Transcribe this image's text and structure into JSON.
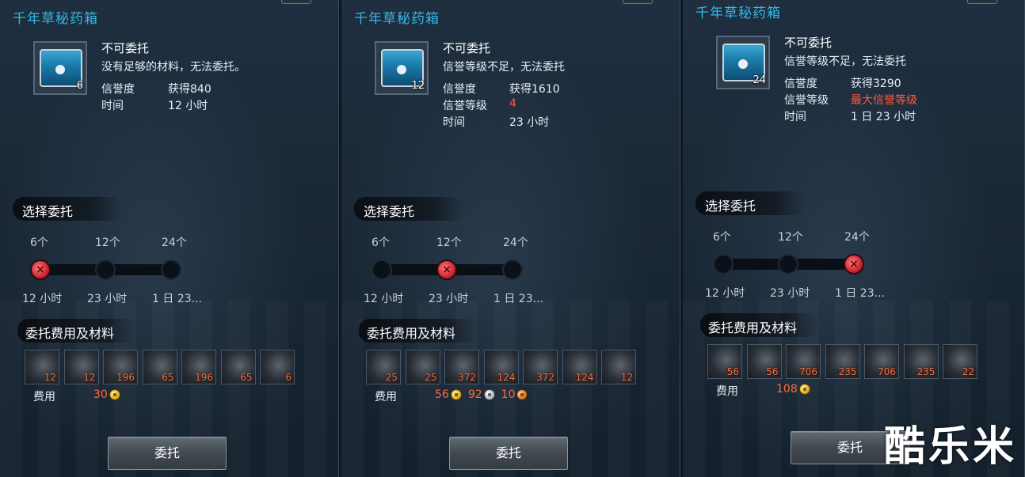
{
  "panels": [
    {
      "title": "千年草秘药箱",
      "item_qty": "6",
      "status": "不可委托",
      "reason": "没有足够的材料，无法委托。",
      "info": [
        {
          "label": "信誉度",
          "value": "获得840",
          "highlight": false
        },
        {
          "label": "时间",
          "value": "12 小时",
          "highlight": false
        }
      ],
      "section_choose": "选择委托",
      "options": [
        "6个",
        "12个",
        "24个"
      ],
      "durations": [
        "12 小时",
        "23 小时",
        "1 日 23..."
      ],
      "selected_option_index": 0,
      "section_cost": "委托费用及材料",
      "materials": [
        "12",
        "12",
        "196",
        "65",
        "196",
        "65",
        "6"
      ],
      "fee_label": "费用",
      "fees": [
        {
          "amount": "30",
          "coin": "gold"
        }
      ],
      "button": "委托"
    },
    {
      "title": "千年草秘药箱",
      "item_qty": "12",
      "status": "不可委托",
      "reason": "信誉等级不足，无法委托",
      "info": [
        {
          "label": "信誉度",
          "value": "获得1610",
          "highlight": false
        },
        {
          "label": "信誉等级",
          "value": "4",
          "highlight": true
        },
        {
          "label": "时间",
          "value": "23 小时",
          "highlight": false
        }
      ],
      "section_choose": "选择委托",
      "options": [
        "6个",
        "12个",
        "24个"
      ],
      "durations": [
        "12 小时",
        "23 小时",
        "1 日 23..."
      ],
      "selected_option_index": 1,
      "section_cost": "委托费用及材料",
      "materials": [
        "25",
        "25",
        "372",
        "124",
        "372",
        "124",
        "12"
      ],
      "fee_label": "费用",
      "fees": [
        {
          "amount": "56",
          "coin": "gold"
        },
        {
          "amount": "92",
          "coin": "silver"
        },
        {
          "amount": "10",
          "coin": "copper"
        }
      ],
      "button": "委托"
    },
    {
      "title": "千年草秘药箱",
      "item_qty": "24",
      "status": "不可委托",
      "reason": "信誉等级不足，无法委托",
      "info": [
        {
          "label": "信誉度",
          "value": "获得3290",
          "highlight": false
        },
        {
          "label": "信誉等级",
          "value": "最大信誉等级",
          "highlight": true
        },
        {
          "label": "时间",
          "value": "1 日 23 小时",
          "highlight": false
        }
      ],
      "section_choose": "选择委托",
      "options": [
        "6个",
        "12个",
        "24个"
      ],
      "durations": [
        "12 小时",
        "23 小时",
        "1 日 23..."
      ],
      "selected_option_index": 2,
      "section_cost": "委托费用及材料",
      "materials": [
        "56",
        "56",
        "706",
        "235",
        "706",
        "235",
        "22"
      ],
      "fee_label": "费用",
      "fees": [
        {
          "amount": "108",
          "coin": "gold"
        }
      ],
      "button": "委托"
    }
  ],
  "watermark": "酷乐米",
  "colors": {
    "title": "#35b7e6",
    "highlight_red": "#ff5a3a",
    "material_count": "#ff6b3a"
  }
}
